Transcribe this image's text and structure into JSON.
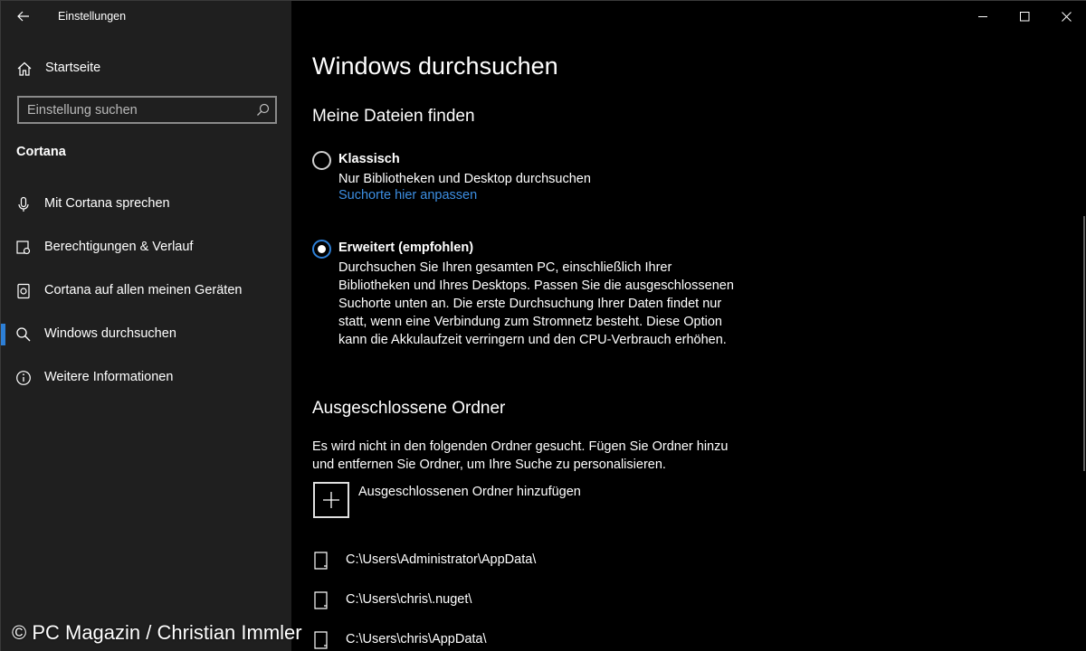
{
  "window": {
    "title": "Einstellungen"
  },
  "sidebar": {
    "home_label": "Startseite",
    "search_placeholder": "Einstellung suchen",
    "section": "Cortana",
    "items": [
      {
        "label": "Mit Cortana sprechen",
        "icon": "microphone-icon"
      },
      {
        "label": "Berechtigungen & Verlauf",
        "icon": "permissions-icon"
      },
      {
        "label": "Cortana auf allen meinen Geräten",
        "icon": "devices-icon"
      },
      {
        "label": "Windows durchsuchen",
        "icon": "search-icon",
        "selected": true
      },
      {
        "label": "Weitere Informationen",
        "icon": "info-icon"
      }
    ]
  },
  "main": {
    "title": "Windows durchsuchen",
    "find_section": {
      "heading": "Meine Dateien finden",
      "options": [
        {
          "title": "Klassisch",
          "description": "Nur Bibliotheken und Desktop durchsuchen",
          "link": "Suchorte hier anpassen",
          "selected": false
        },
        {
          "title": "Erweitert (empfohlen)",
          "description": "Durchsuchen Sie Ihren gesamten PC, einschließlich Ihrer Bibliotheken und Ihres Desktops. Passen Sie die ausgeschlossenen Suchorte unten an. Die erste Durchsuchung Ihrer Daten findet nur statt, wenn eine Verbindung zum Stromnetz besteht. Diese Option kann die Akkulaufzeit verringern und den CPU-Verbrauch erhöhen.",
          "selected": true
        }
      ]
    },
    "excluded_section": {
      "heading": "Ausgeschlossene Ordner",
      "description": "Es wird nicht in den folgenden Ordner gesucht. Fügen Sie Ordner hinzu und entfernen Sie Ordner, um Ihre Suche zu personalisieren.",
      "add_label": "Ausgeschlossenen Ordner hinzufügen",
      "folders": [
        "C:\\Users\\Administrator\\AppData\\",
        "C:\\Users\\chris\\.nuget\\",
        "C:\\Users\\chris\\AppData\\"
      ]
    }
  },
  "watermark": "© PC Magazin / Christian Immler",
  "colors": {
    "accent": "#2d7fd6",
    "link": "#3d8fe3",
    "sidebar_bg": "#1f1f1f",
    "main_bg": "#000000"
  }
}
